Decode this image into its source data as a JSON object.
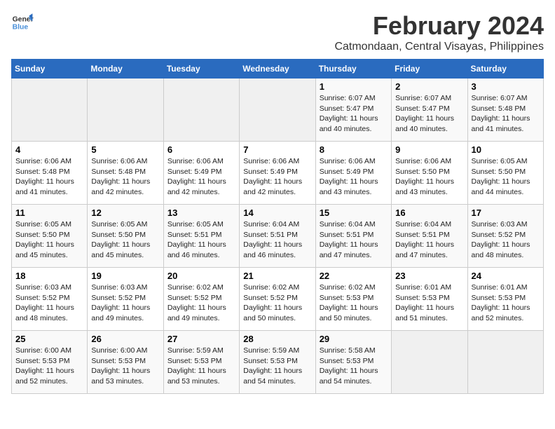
{
  "logo": {
    "line1": "General",
    "line2": "Blue"
  },
  "title": "February 2024",
  "subtitle": "Catmondaan, Central Visayas, Philippines",
  "days_of_week": [
    "Sunday",
    "Monday",
    "Tuesday",
    "Wednesday",
    "Thursday",
    "Friday",
    "Saturday"
  ],
  "weeks": [
    [
      {
        "day": "",
        "info": ""
      },
      {
        "day": "",
        "info": ""
      },
      {
        "day": "",
        "info": ""
      },
      {
        "day": "",
        "info": ""
      },
      {
        "day": "1",
        "info": "Sunrise: 6:07 AM\nSunset: 5:47 PM\nDaylight: 11 hours\nand 40 minutes."
      },
      {
        "day": "2",
        "info": "Sunrise: 6:07 AM\nSunset: 5:47 PM\nDaylight: 11 hours\nand 40 minutes."
      },
      {
        "day": "3",
        "info": "Sunrise: 6:07 AM\nSunset: 5:48 PM\nDaylight: 11 hours\nand 41 minutes."
      }
    ],
    [
      {
        "day": "4",
        "info": "Sunrise: 6:06 AM\nSunset: 5:48 PM\nDaylight: 11 hours\nand 41 minutes."
      },
      {
        "day": "5",
        "info": "Sunrise: 6:06 AM\nSunset: 5:48 PM\nDaylight: 11 hours\nand 42 minutes."
      },
      {
        "day": "6",
        "info": "Sunrise: 6:06 AM\nSunset: 5:49 PM\nDaylight: 11 hours\nand 42 minutes."
      },
      {
        "day": "7",
        "info": "Sunrise: 6:06 AM\nSunset: 5:49 PM\nDaylight: 11 hours\nand 42 minutes."
      },
      {
        "day": "8",
        "info": "Sunrise: 6:06 AM\nSunset: 5:49 PM\nDaylight: 11 hours\nand 43 minutes."
      },
      {
        "day": "9",
        "info": "Sunrise: 6:06 AM\nSunset: 5:50 PM\nDaylight: 11 hours\nand 43 minutes."
      },
      {
        "day": "10",
        "info": "Sunrise: 6:05 AM\nSunset: 5:50 PM\nDaylight: 11 hours\nand 44 minutes."
      }
    ],
    [
      {
        "day": "11",
        "info": "Sunrise: 6:05 AM\nSunset: 5:50 PM\nDaylight: 11 hours\nand 45 minutes."
      },
      {
        "day": "12",
        "info": "Sunrise: 6:05 AM\nSunset: 5:50 PM\nDaylight: 11 hours\nand 45 minutes."
      },
      {
        "day": "13",
        "info": "Sunrise: 6:05 AM\nSunset: 5:51 PM\nDaylight: 11 hours\nand 46 minutes."
      },
      {
        "day": "14",
        "info": "Sunrise: 6:04 AM\nSunset: 5:51 PM\nDaylight: 11 hours\nand 46 minutes."
      },
      {
        "day": "15",
        "info": "Sunrise: 6:04 AM\nSunset: 5:51 PM\nDaylight: 11 hours\nand 47 minutes."
      },
      {
        "day": "16",
        "info": "Sunrise: 6:04 AM\nSunset: 5:51 PM\nDaylight: 11 hours\nand 47 minutes."
      },
      {
        "day": "17",
        "info": "Sunrise: 6:03 AM\nSunset: 5:52 PM\nDaylight: 11 hours\nand 48 minutes."
      }
    ],
    [
      {
        "day": "18",
        "info": "Sunrise: 6:03 AM\nSunset: 5:52 PM\nDaylight: 11 hours\nand 48 minutes."
      },
      {
        "day": "19",
        "info": "Sunrise: 6:03 AM\nSunset: 5:52 PM\nDaylight: 11 hours\nand 49 minutes."
      },
      {
        "day": "20",
        "info": "Sunrise: 6:02 AM\nSunset: 5:52 PM\nDaylight: 11 hours\nand 49 minutes."
      },
      {
        "day": "21",
        "info": "Sunrise: 6:02 AM\nSunset: 5:52 PM\nDaylight: 11 hours\nand 50 minutes."
      },
      {
        "day": "22",
        "info": "Sunrise: 6:02 AM\nSunset: 5:53 PM\nDaylight: 11 hours\nand 50 minutes."
      },
      {
        "day": "23",
        "info": "Sunrise: 6:01 AM\nSunset: 5:53 PM\nDaylight: 11 hours\nand 51 minutes."
      },
      {
        "day": "24",
        "info": "Sunrise: 6:01 AM\nSunset: 5:53 PM\nDaylight: 11 hours\nand 52 minutes."
      }
    ],
    [
      {
        "day": "25",
        "info": "Sunrise: 6:00 AM\nSunset: 5:53 PM\nDaylight: 11 hours\nand 52 minutes."
      },
      {
        "day": "26",
        "info": "Sunrise: 6:00 AM\nSunset: 5:53 PM\nDaylight: 11 hours\nand 53 minutes."
      },
      {
        "day": "27",
        "info": "Sunrise: 5:59 AM\nSunset: 5:53 PM\nDaylight: 11 hours\nand 53 minutes."
      },
      {
        "day": "28",
        "info": "Sunrise: 5:59 AM\nSunset: 5:53 PM\nDaylight: 11 hours\nand 54 minutes."
      },
      {
        "day": "29",
        "info": "Sunrise: 5:58 AM\nSunset: 5:53 PM\nDaylight: 11 hours\nand 54 minutes."
      },
      {
        "day": "",
        "info": ""
      },
      {
        "day": "",
        "info": ""
      }
    ]
  ]
}
